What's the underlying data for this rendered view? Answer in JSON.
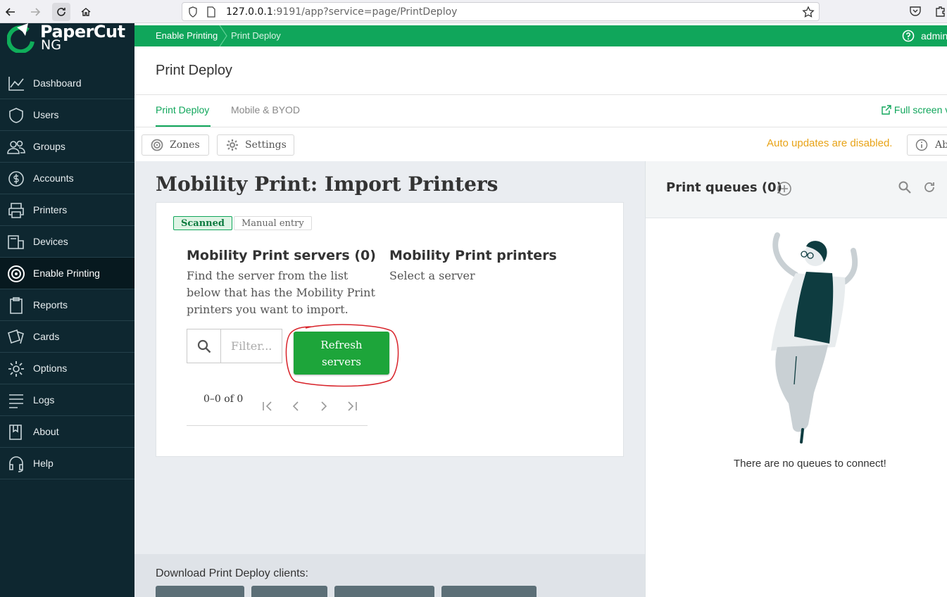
{
  "browser": {
    "url_host": "127.0.0.1",
    "url_rest": ":9191/app?service=page/PrintDeploy"
  },
  "brand": {
    "name_line1": "PaperCut",
    "name_line2": "NG",
    "accent": "#10a65b"
  },
  "sidebar": {
    "items": [
      {
        "label": "Dashboard",
        "icon": "chart-line-icon"
      },
      {
        "label": "Users",
        "icon": "user-shield-icon"
      },
      {
        "label": "Groups",
        "icon": "groups-icon"
      },
      {
        "label": "Accounts",
        "icon": "dollar-circle-icon"
      },
      {
        "label": "Printers",
        "icon": "printer-icon"
      },
      {
        "label": "Devices",
        "icon": "device-icon"
      },
      {
        "label": "Enable Printing",
        "icon": "target-icon",
        "active": true
      },
      {
        "label": "Reports",
        "icon": "clipboard-icon"
      },
      {
        "label": "Cards",
        "icon": "cards-icon"
      },
      {
        "label": "Options",
        "icon": "gear-icon"
      },
      {
        "label": "Logs",
        "icon": "list-icon"
      },
      {
        "label": "About",
        "icon": "book-icon"
      },
      {
        "label": "Help",
        "icon": "headset-icon"
      }
    ]
  },
  "breadcrumb": {
    "first": "Enable Printing",
    "second": "Print Deploy",
    "user": "admin"
  },
  "page": {
    "title": "Print Deploy",
    "tabs": [
      "Print Deploy",
      "Mobile & BYOD"
    ],
    "fullscreen_label": "Full screen v",
    "toolbar": {
      "zones": "Zones",
      "settings": "Settings",
      "about": "Ab"
    },
    "auto_updates": "Auto updates are disabled."
  },
  "import": {
    "title": "Mobility Print: Import Printers",
    "tag_scanned": "Scanned",
    "tag_manual": "Manual entry",
    "servers_heading": "Mobility Print servers (0)",
    "servers_desc": "Find the server from the list below that has the Mobility Print printers you want to import.",
    "printers_heading": "Mobility Print printers",
    "printers_desc": "Select a server",
    "filter_placeholder": "Filter...",
    "refresh_button": "Refresh servers",
    "pager": "0–0 of 0"
  },
  "queues": {
    "title": "Print queues (0)",
    "empty_message": "There are no queues to connect!"
  },
  "download": {
    "label": "Download Print Deploy clients:"
  }
}
